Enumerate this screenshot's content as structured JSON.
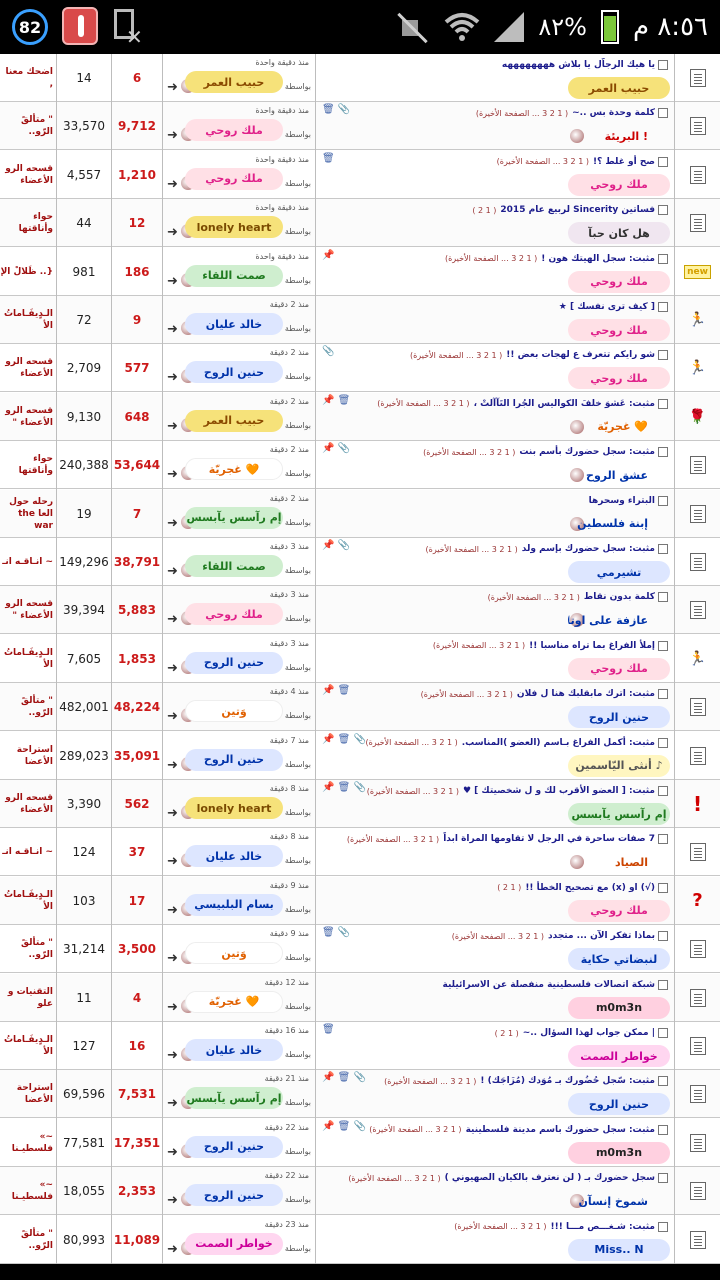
{
  "status_bar": {
    "notification_count": "82",
    "clock": "٨:٥٦ م",
    "battery_percent": "٨٢%",
    "battery_level": 0.82,
    "icons": [
      "notification-badge-icon",
      "thermometer-app-icon",
      "no-sim-icon",
      "mute-icon",
      "wifi-icon",
      "signal-icon",
      "battery-icon"
    ]
  },
  "labels": {
    "by": "بواسطة"
  },
  "colors": {
    "replies": "#cc1a1a",
    "forum": "#a01010",
    "title": "#1c1c8c"
  },
  "rows": [
    {
      "forum": "اضحك معنا ,",
      "views": "14",
      "replies": "6",
      "ago": "منذ دقيقة واحدة",
      "last_user": "حبيب العمر",
      "last_bg": "#f6e27a",
      "last_color": "#8a4a00",
      "title": "يا هيك الرجاّل يا بلاش ههههههههه",
      "pages": "",
      "icons": "",
      "poster": "حبيب العمر",
      "poster_bg": "#f6e27a",
      "poster_color": "#8a4a00",
      "poster_pill": true,
      "status_icon": "doc"
    },
    {
      "forum": "\" متألقً الرّو..",
      "views": "33,570",
      "replies": "9,712",
      "ago": "منذ دقيقة واحدة",
      "last_user": "ملك روحي",
      "last_bg": "#ffe0e6",
      "last_color": "#e0218a",
      "title": "كلمة وحدة بس ..~",
      "pages": "( 1 2 3 ... الصفحة الأخيرة)",
      "icons": "🗑 📎",
      "poster": "البريئة !",
      "poster_bg": "#ffffff",
      "poster_color": "#cc0000",
      "poster_pill": false,
      "status_icon": "doc"
    },
    {
      "forum": "قسحه الرو الأعضاء",
      "views": "4,557",
      "replies": "1,210",
      "ago": "منذ دقيقة واحدة",
      "last_user": "ملك روحي",
      "last_bg": "#ffe0e6",
      "last_color": "#e0218a",
      "title": "صح أو غلط ؟!",
      "pages": "( 1 2 3 ... الصفحة الأخيرة)",
      "icons": "🗑",
      "poster": "ملك روحي",
      "poster_bg": "#ffe0e6",
      "poster_color": "#e0218a",
      "poster_pill": true,
      "status_icon": "doc"
    },
    {
      "forum": "حواء وأناقتها",
      "views": "44",
      "replies": "12",
      "ago": "منذ دقيقة واحدة",
      "last_user": "lonely heart",
      "last_bg": "#f6e27a",
      "last_color": "#7a4a00",
      "title": "فساتين Sincerity لربيع عام 2015",
      "pages": "( 1 2 )",
      "icons": "",
      "poster": "هل كان حبآ",
      "poster_bg": "#f0e6f0",
      "poster_color": "#333333",
      "poster_pill": true,
      "status_icon": "doc"
    },
    {
      "forum": "{.. ظَلالْ الإ",
      "views": "981",
      "replies": "186",
      "ago": "منذ دقيقة واحدة",
      "last_user": "صمت اللقاء",
      "last_bg": "#cfeecf",
      "last_color": "#1f7a1f",
      "title": "مثبت: سجل الهيتك هون !",
      "pages": "( 1 2 3 ... الصفحة الأخيرة)",
      "icons": "📌",
      "poster": "ملك روحي",
      "poster_bg": "#ffe0e6",
      "poster_color": "#e0218a",
      "poster_pill": true,
      "status_icon": "new"
    },
    {
      "forum": "الـدٍيفَـاماتُ الأ",
      "views": "72",
      "replies": "9",
      "ago": "منذ 2 دقيقة",
      "last_user": "خالد عليان",
      "last_bg": "#dde6ff",
      "last_color": "#0033aa",
      "title": "[ كيف ترى نفسك ] ★",
      "pages": "",
      "icons": "",
      "poster": "ملك روحي",
      "poster_bg": "#ffe0e6",
      "poster_color": "#e0218a",
      "poster_pill": true,
      "status_icon": "run"
    },
    {
      "forum": "قسحه الرو الأعضاء",
      "views": "2,709",
      "replies": "577",
      "ago": "منذ 2 دقيقة",
      "last_user": "حنين الروح",
      "last_bg": "#dde6ff",
      "last_color": "#0033aa",
      "title": "شو رايكم تتعرف ع لهجات بعض !!",
      "pages": "( 1 2 3 ... الصفحة الأخيرة)",
      "icons": "📎",
      "poster": "ملك روحي",
      "poster_bg": "#ffe0e6",
      "poster_color": "#e0218a",
      "poster_pill": true,
      "status_icon": "run"
    },
    {
      "forum": "قسحه الرو الأعضاء \"",
      "views": "9,130",
      "replies": "648",
      "ago": "منذ 2 دقيقة",
      "last_user": "حبيب العمر",
      "last_bg": "#f6e27a",
      "last_color": "#8a4a00",
      "title": "مثبت: عَشوَ خلفَ الكواليس الجُرا التَآآلتْ ،",
      "pages": "( 1 2 3 ... الصفحة الأخيرة)",
      "icons": "📌 🗑",
      "poster": "غجريّة 🧡",
      "poster_bg": "#ffffff",
      "poster_color": "#e06000",
      "poster_pill": false,
      "status_icon": "rose"
    },
    {
      "forum": "حواء وأناقتها",
      "views": "240,388",
      "replies": "53,644",
      "ago": "منذ 2 دقيقة",
      "last_user": "غجريّة 🧡",
      "last_bg": "#ffffff",
      "last_color": "#e06000",
      "title": "مثبت: سجل حضورك بأسم بنت",
      "pages": "( 1 2 3 ... الصفحة الأخيرة)",
      "icons": "📌 📎",
      "poster": "عشق الروح",
      "poster_bg": "#ffffff",
      "poster_color": "#0033aa",
      "poster_pill": false,
      "status_icon": "doc"
    },
    {
      "forum": "رحله حول العا the war",
      "views": "19",
      "replies": "7",
      "ago": "منذ 2 دقيقة",
      "last_user": "إم رآسس يآبسس",
      "last_bg": "#cfeecf",
      "last_color": "#1f7a1f",
      "title": "البتراء وسحرها",
      "pages": "",
      "icons": "",
      "poster": "إبنة فلسطين",
      "poster_bg": "#ffffff",
      "poster_color": "#0033aa",
      "poster_pill": false,
      "status_icon": "doc"
    },
    {
      "forum": "~ انـاقـه انـ",
      "views": "149,296",
      "replies": "38,791",
      "ago": "منذ 3 دقيقة",
      "last_user": "صمت اللقاء",
      "last_bg": "#cfeecf",
      "last_color": "#1f7a1f",
      "title": "مثبت: سجل حضورك بإسم ولد",
      "pages": "( 1 2 3 ... الصفحة الأخيرة)",
      "icons": "📌 📎",
      "poster": "تشيرمي",
      "poster_bg": "#dde6ff",
      "poster_color": "#0033aa",
      "poster_pill": true,
      "status_icon": "doc"
    },
    {
      "forum": "قسحه الرو الأعضاء \"",
      "views": "39,394",
      "replies": "5,883",
      "ago": "منذ 3 دقيقة",
      "last_user": "ملك روحي",
      "last_bg": "#ffe0e6",
      "last_color": "#e0218a",
      "title": "كلمة بدون نقاط",
      "pages": "( 1 2 3 ... الصفحة الأخيرة)",
      "icons": "",
      "poster": "عازفة على اوتار الحب",
      "poster_bg": "#ffffff",
      "poster_color": "#0033aa",
      "poster_pill": false,
      "status_icon": "doc"
    },
    {
      "forum": "الـدٍيفَـاماتُ الأ",
      "views": "7,605",
      "replies": "1,853",
      "ago": "منذ 3 دقيقة",
      "last_user": "حنين الروح",
      "last_bg": "#dde6ff",
      "last_color": "#0033aa",
      "title": "إملأ الفراغ بما تراه مناسبا !!",
      "pages": "( 1 2 3 ... الصفحة الأخيرة)",
      "icons": "",
      "poster": "ملك روحي",
      "poster_bg": "#ffe0e6",
      "poster_color": "#e0218a",
      "poster_pill": true,
      "status_icon": "run"
    },
    {
      "forum": "\" متألقً الرّو..",
      "views": "482,001",
      "replies": "48,224",
      "ago": "منذ 4 دقيقة",
      "last_user": "وَتين",
      "last_bg": "#ffffff",
      "last_color": "#e06000",
      "title": "مثبت: اترك مابقلبك هنا ل فلان",
      "pages": "( 1 2 3 ... الصفحة الأخيرة)",
      "icons": "📌 🗑",
      "poster": "حنين الروح",
      "poster_bg": "#dde6ff",
      "poster_color": "#0033aa",
      "poster_pill": true,
      "status_icon": "doc"
    },
    {
      "forum": "استراحة الأعضا",
      "views": "289,023",
      "replies": "35,091",
      "ago": "منذ 7 دقيقة",
      "last_user": "حنين الروح",
      "last_bg": "#dde6ff",
      "last_color": "#0033aa",
      "title": "مثبت: أكمل الفراغ بـاسم (العضو )المناسب.",
      "pages": "( 1 2 3 ... الصفحة الأخيرة)",
      "icons": "📌 🗑 📎",
      "poster": "أنثى اليّاسمين ♪",
      "poster_bg": "#fff6c0",
      "poster_color": "#555555",
      "poster_pill": true,
      "status_icon": "doc"
    },
    {
      "forum": "قسحه الرو الأعضاء",
      "views": "3,390",
      "replies": "562",
      "ago": "منذ 8 دقيقة",
      "last_user": "lonely heart",
      "last_bg": "#f6e27a",
      "last_color": "#7a4a00",
      "title": "مثبت: [ العضو الأقرب لك و ل شخصيتك ] ♥",
      "pages": "( 1 2 3 ... الصفحة الأخيرة)",
      "icons": "📌 🗑 📎",
      "poster": "إم رآسس يآبسس",
      "poster_bg": "#cfeecf",
      "poster_color": "#1f7a1f",
      "poster_pill": true,
      "status_icon": "alert"
    },
    {
      "forum": "~ انـاقـه انـ",
      "views": "124",
      "replies": "37",
      "ago": "منذ 8 دقيقة",
      "last_user": "خالد عليان",
      "last_bg": "#dde6ff",
      "last_color": "#0033aa",
      "title": "7 صفات ساحرة في الرجل لا تقاومها المراة ابداً",
      "pages": "( 1 2 3 ... الصفحة الأخيرة)",
      "icons": "",
      "poster": "الصياد",
      "poster_bg": "#ffffff",
      "poster_color": "#cc4400",
      "poster_pill": false,
      "status_icon": "doc"
    },
    {
      "forum": "الـدٍيفَـاماتُ الأ",
      "views": "103",
      "replies": "17",
      "ago": "منذ 9 دقيقة",
      "last_user": "بسام البلبيسي",
      "last_bg": "#dde6ff",
      "last_color": "#0033aa",
      "title": "(√) او (x) مع تصحيح الخطأ !!",
      "pages": "( 1 2 )",
      "icons": "",
      "poster": "ملك روحي",
      "poster_bg": "#ffe0e6",
      "poster_color": "#e0218a",
      "poster_pill": true,
      "status_icon": "question"
    },
    {
      "forum": "\" متألقً الرّو..",
      "views": "31,214",
      "replies": "3,500",
      "ago": "منذ 9 دقيقة",
      "last_user": "وَتين",
      "last_bg": "#ffffff",
      "last_color": "#e06000",
      "title": "بماذا تفكر الآن ... متجدد",
      "pages": "( 1 2 3 ... الصفحة الأخيرة)",
      "icons": "🗑 📎",
      "poster": "لنبضاتي حكاية",
      "poster_bg": "#dde6ff",
      "poster_color": "#0033aa",
      "poster_pill": true,
      "status_icon": "doc"
    },
    {
      "forum": "التقنيات و علو",
      "views": "11",
      "replies": "4",
      "ago": "منذ 12 دقيقة",
      "last_user": "غجريّة 🧡",
      "last_bg": "#ffffff",
      "last_color": "#e06000",
      "title": "شبكة اتصالات فلسطينية منفصلة عن الاسرائيلية",
      "pages": "",
      "icons": "",
      "poster": "m0m3n",
      "poster_bg": "#ffd0e0",
      "poster_color": "#222222",
      "poster_pill": true,
      "status_icon": "doc"
    },
    {
      "forum": "الـدٍيفَـاماتُ الأ",
      "views": "127",
      "replies": "16",
      "ago": "منذ 16 دقيقة",
      "last_user": "خالد عليان",
      "last_bg": "#dde6ff",
      "last_color": "#0033aa",
      "title": "| ممكن جواب لهذا السؤال ..~",
      "pages": "( 1 2 )",
      "icons": "🗑",
      "poster": "خواطر الصمت",
      "poster_bg": "#ffd6f0",
      "poster_color": "#cc0099",
      "poster_pill": true,
      "status_icon": "doc"
    },
    {
      "forum": "استراحة الأعضا",
      "views": "69,596",
      "replies": "7,531",
      "ago": "منذ 21 دقيقة",
      "last_user": "إم رآسس يآبسس",
      "last_bg": "#cfeecf",
      "last_color": "#1f7a1f",
      "title": "مثبت: سّجل حُضُورك بـ مُوَدك (مُزَاجَك) !",
      "pages": "( 1 2 3 ... الصفحة الأخيرة)",
      "icons": "📌 🗑 📎",
      "poster": "حنين الروح",
      "poster_bg": "#dde6ff",
      "poster_color": "#0033aa",
      "poster_pill": true,
      "status_icon": "doc"
    },
    {
      "forum": "~» فلسطيـنا",
      "views": "77,581",
      "replies": "17,351",
      "ago": "منذ 22 دقيقة",
      "last_user": "حنين الروح",
      "last_bg": "#dde6ff",
      "last_color": "#0033aa",
      "title": "مثبت: سجل حضورك باسم مدينة فلسطينية",
      "pages": "( 1 2 3 ... الصفحة الأخيرة)",
      "icons": "📌 🗑 📎",
      "poster": "m0m3n",
      "poster_bg": "#ffd0e0",
      "poster_color": "#222222",
      "poster_pill": true,
      "status_icon": "doc"
    },
    {
      "forum": "~» فلسطيـنا",
      "views": "18,055",
      "replies": "2,353",
      "ago": "منذ 22 دقيقة",
      "last_user": "حنين الروح",
      "last_bg": "#dde6ff",
      "last_color": "#0033aa",
      "title": "سجل حضورك بـ ( لن نعترف بالكيان الصهيوني )",
      "pages": "( 1 2 3 ... الصفحة الأخيرة)",
      "icons": "",
      "poster": "شموخ إنسآن",
      "poster_bg": "#ffffff",
      "poster_color": "#0033aa",
      "poster_pill": false,
      "status_icon": "doc"
    },
    {
      "forum": "\" متألقً الرّو..",
      "views": "80,993",
      "replies": "11,089",
      "ago": "منذ 23 دقيقة",
      "last_user": "خواطر الصمت",
      "last_bg": "#ffd6f0",
      "last_color": "#cc0099",
      "title": "مثبت: شـغـــص مـــا !!!",
      "pages": "( 1 2 3 ... الصفحة الأخيرة)",
      "icons": "",
      "poster": "Miss.. N",
      "poster_bg": "#dde6ff",
      "poster_color": "#0033aa",
      "poster_pill": true,
      "status_icon": "doc"
    }
  ]
}
